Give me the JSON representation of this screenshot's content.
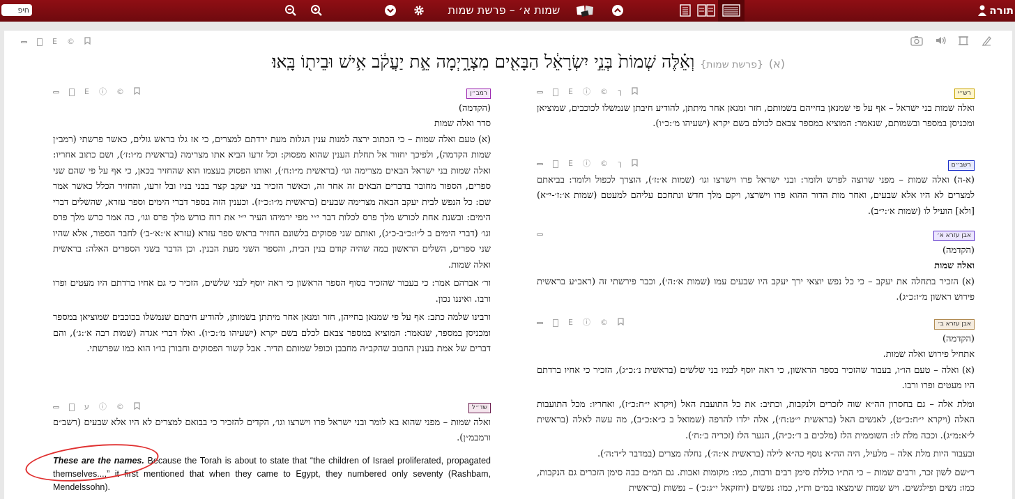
{
  "toolbar": {
    "search_placeholder": "חיפ",
    "title": "שמות א׳ – פרשת שמות",
    "brand": "תורה",
    "icons": [
      "zoom-out-icon",
      "zoom-in-icon",
      "chevron-down-icon",
      "gear-icon",
      "open-book-icon",
      "chevron-up-icon",
      "layout-1col-icon",
      "layout-2col-icon",
      "layout-list-icon",
      "user-icon"
    ]
  },
  "verse": {
    "number": "(א)",
    "parasha": "{פרשת שמות}",
    "text": "וְאֵ֗לֶּה שְׁמוֹת֙ בְּנֵ֣י יִשְׂרָאֵ֔ל הַבָּאִ֖ים מִצְרָ֑יְמָה אֵ֣ת יַעֲקֹ֔ב אִ֥ישׁ וּבֵית֖וֹ בָּֽאוּ׃"
  },
  "left": {
    "ramban": {
      "tag": "רמב״ן",
      "intro": "(הקדמה)",
      "heading": "סדר ואלה שמות",
      "p1": "(א) טעם ואלה שמות – כי הכתוב ירצה למנות ענין הגלות מעת ירדתם למצרים, כי אז גלו בראש גולים, כאשר פרשתי (רמב״ן שמות הקדמה), ולפיכך יחזור אל תחלת הענין שהוא מפסוק: וכל זרעו הביא אתו מצרימה (בראשית מ״ו:ז׳), ושם כתוב אחריו: ואלה שמות בני ישראל הבאים מצרימה וגו׳ (בראשית מ״ו:ח׳), ואותו הפסוק בעצמו הוא שהחזיר בכאן, כי אף על פי שהם שני ספרים, הספור מחובר בדברים הבאים זה אחר זה, וכאשר הזכיר בני יעקב קצר בבני בניו ובל זרעו, והחזיר הכלל כאשר אמר שם: כל הנפש לבית יעקב הבאה מצרימה שבעים (בראשית מ״ו:כ״ז). וכענין הזה בספר דברי הימים וספר עזרא, שהשלים דברי הימים: ובשנת אחת לכורש מלך פרס לכלות דבר י״י מפי ירמיהו העיר י״י את רוח כורש מלך פרס וגו׳, כה אמר כרש מלך פרס וגו׳ (דברי הימים ב ל״ו:כ״ב-כ״ג), ואותם שני פסוקים בלשונם החזיר בראש ספר עזרא (עזרא א׳:א׳-ב׳) לחבר הספור, אלא שהיו שני ספרים, השלים הראשון במה שהיה קודם בנין הבית, והספר השני מעת הבנין. וכן הדבר בשני הספרים האלה: בראשית ואלה שמות.",
      "p2": "ור׳ אברהם אמר: כי בעבור שהזכיר בסוף הספר הראשון כי ראה יוסף לבני שלשים, הזכיר כי גם אחיו ברדתם היו מעטים ופרו ורבו. ואיננו נכון.",
      "p3": "ורבינו שלמה כתב: אף על פי שמנאן בחייהן, חזר ומנאן אחר מיתתן בשמותן, להודיע חיבתם שנמשלו בכוכבים שמוציאן במספר ומכניסן במספר, שנאמר: המוציא במספר צבאם לכלם בשם יקרא (ישעיהו מ׳:כ״ו). ואלו דברי אגדה (שמות רבה א׳:ג׳), והם דברים של אמת בענין החבוב שהקב״ה מחבבן וכופל שמותם תדיר. אבל קשור הפסוקים וחבורן בו״ו הוא כמו שפרשתי."
    },
    "shadal": {
      "tag": "שד״ל",
      "text": "ואלה שמות – מפני שהוא בא לומר ובני ישראל פרו וישרצו וגו׳, הקדים להזכיר כי בבואם למצרים לא היו אלא שבעים (רשב״ם ורמבמ״ן)."
    },
    "english": {
      "lead": "These are the names.",
      "text": " Because the Torah is about to state that “the children of Israel proliferated, propagated themselves...,” it first mentioned that when they came to Egypt, they numbered only seventy (Rashbam, Mendelssohn)."
    }
  },
  "right": {
    "rashi": {
      "tag": "רש״י",
      "text": "ואלה שמות בני ישראל – אף על פי שמנאן בחייהם בשמותם, חזר ומנאן אחר מיתתן, להודיע חיבתן שנמשלו לכוכבים, שמוציאן ומכניסן במספר ובשמותם, שנאמר: המוציא במספר צבאם לכולם בשם יקרא (ישעיהו מ׳:כ״ו)."
    },
    "rashbam": {
      "tag": "רשב״ם",
      "text": "(א-ה) ואלה שמות – מפני שרוצה לפרש ולומר: ובני ישראל פרו וישרצו וגו׳ (שמות א׳:ז׳), הוצרך לכפול ולומר: בביאתם למצרים לא היו אלא שבעים, ואחר מות הדור ההוא פרו וישרצו, ויקם מלך חדש ונתחכם עליהם למעטם (שמות א׳:ז׳-י״א) [ולא] הועיל לו (שמות א׳:י״ב)."
    },
    "ibn_ezra_a": {
      "tag": "אבן עזרא א׳",
      "intro": "(הקדמה)",
      "heading": "ואלה שמות",
      "text": "(א) הזכיר בתחלה את יעקב – כי כל נפש יוצאי ירך יעקב היו שבעים עמו (שמות א׳:ה׳), וכבר פירשתי זה (ראב״ע בראשית פירוש ראשון מ״ו:כ״ג)."
    },
    "ibn_ezra_b": {
      "tag": "אבן עזרא ב׳",
      "intro": "(הקדמה)",
      "heading": "אתחיל פירוש ואלה שמות.",
      "p1": "(א) ואלה – טעם הו״ו, בעבור שהזכיר בספר הראשון, כי ראה יוסף לבניו בני שלשים (בראשית נ׳:כ״ג), הזכיר כי אחיו ברדתם היו מעטים ופרו ורבו.",
      "p2": "ומלת אלה – גם בחסרון הה״א שוה לזכרים ולנקבות, וכתיב: את כל התועבת האל (ויקרא י״ח:כ״ז), ואחריו: מכל התועבות האלה (ויקרא י״ח:כ״ט), לאנשים האל (בראשית י״ט:ח׳), אלה ילדו להרפה (שמואל ב כ״א:כ״ב), מה עשה לאלה (בראשית ל״א:מ״ג). וככה מלת לו: השוממית הלז (מלכים ב ד׳:כ״ה), הנער הלז (זכריה ב׳:ח׳).",
      "p3": "ובעבור היות מלת אלה – מלעיל, היה הה״א נוסף כה״א לילה (בראשית א׳:ה׳), נחלה מצרים (במדבר ל״ד:ה׳).",
      "p4": "ר״שם לשון זכר, ורבים שמות – כי הת״ו כוללת סימן רבים ורבות, כמו: מקומות ואבות. גם המ״ם כבה סימן הזכרים גם הנקבות, כמו: נשים ופילגשים. ויש שמות שימצאו במ״ם ות״ו, כמו: נפשים (יחזקאל י״ג:כ׳) – נפשות (בראשית"
    }
  }
}
